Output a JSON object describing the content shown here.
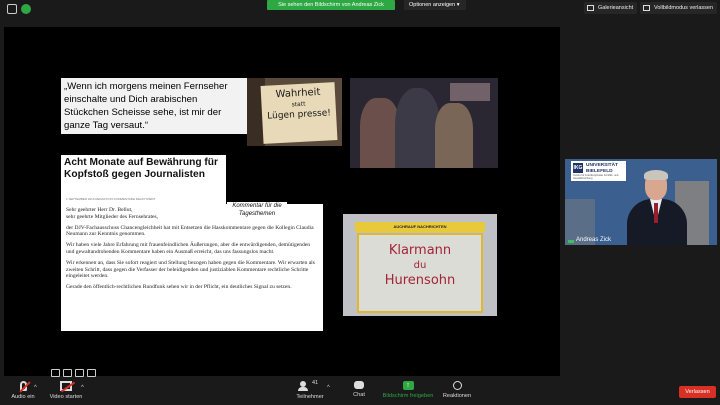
{
  "topbar": {
    "share_banner": "Sie sehen den Bildschirm von Andreas Zick",
    "options_label": "Optionen anzeigen",
    "gallery_label": "Galerieansicht",
    "fullscreen_label": "Vollbildmodus verlassen"
  },
  "slide": {
    "quote": "„Wenn ich morgens meinen Fernseher einschalte und Dich arabischen Stückchen Scheisse sehe, ist mir der ganze Tag versaut.“",
    "sign_text_line1": "Wahrheit",
    "sign_text_line2": "statt",
    "sign_text_line3": "Lügen presse!",
    "headline": "Acht Monate auf Bewährung für Kopfstoß gegen Journalisten",
    "byline": "1 SEPTEMBER 2016    REDAKTION    KOMMENTARE DEAKTIVIERT",
    "caption": "Kommentar für die Tagesthemen",
    "letter_paragraphs": [
      "Sehr geehrter Herr Dr. Bellut,\nsehr geehrte Mitglieder des Fernsehrates,",
      "der DJV-Fachausschuss Chancengleichheit hat mit Entsetzen die Hasskommentare gegen die Kollegin Claudia Neumann zur Kenntnis genommen.",
      "Wir haben viele Jahre Erfahrung mit frauenfeindlichen Äußerungen, aber die entwürdigenden, demütigenden und gewaltandrohenden Kommentare haben ein Ausmaß erreicht, das uns fassungslos macht.",
      "Wir erkennen an, dass Sie sofort reagiert und Stellung bezogen haben gegen die Kommentare. Wir erwarten als zweiten Schritt, dass gegen die Verfasser der beleidigenden und justiziablen Kommentare rechtliche Schritte eingeleitet werden.",
      "Gerade den öffentlich-rechtlichen Rundfunk sehen wir in der Pflicht, ein deutliches Signal zu setzen."
    ],
    "kiosk_sign": "AUCHRAUF NACHRICHTEN",
    "graffiti_line1": "Klarmann",
    "graffiti_line2": "du",
    "graffiti_line3": "Hurensohn"
  },
  "video_tile": {
    "logo_abbrev": "IKG",
    "university_line1": "UNIVERSITÄT",
    "university_line2": "BIELEFELD",
    "institute_text": "Institut für interdisziplinäre Konflikt- und Gewaltforschung",
    "participant_name": "Andreas Zick"
  },
  "bottombar": {
    "audio_label": "Audio ein",
    "video_label": "Video starten",
    "participants_label": "Teilnehmer",
    "participants_count": "41",
    "chat_label": "Chat",
    "share_label": "Bildschirm freigeben",
    "reactions_label": "Reaktionen",
    "leave_label": "Verlassen"
  },
  "colors": {
    "share_green": "#2ea843",
    "leave_red": "#d93025",
    "background": "#1a1a1a"
  }
}
